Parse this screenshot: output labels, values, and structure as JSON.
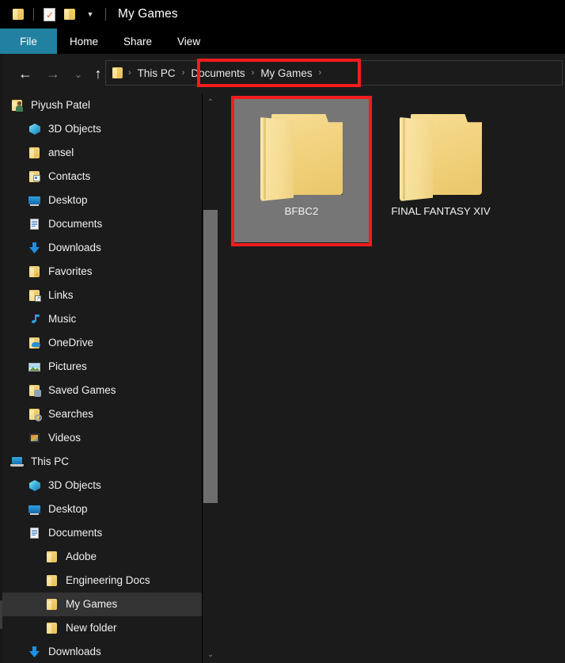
{
  "window": {
    "title": "My Games",
    "quick_access": [
      {
        "name": "folder-icon",
        "label": "Folder"
      },
      {
        "name": "properties-icon",
        "label": "Properties"
      },
      {
        "name": "new-folder-icon",
        "label": "New folder"
      },
      {
        "name": "customize-chevron-icon",
        "label": "Customize Quick Access Toolbar"
      }
    ]
  },
  "ribbon": {
    "tabs": [
      {
        "label": "File",
        "active": true
      },
      {
        "label": "Home",
        "active": false
      },
      {
        "label": "Share",
        "active": false
      },
      {
        "label": "View",
        "active": false
      }
    ],
    "accent_color": "#2280a0"
  },
  "nav": {
    "back": "←",
    "forward": "→",
    "recent": "⌄",
    "up": "↑",
    "breadcrumbs": [
      {
        "label": "This PC"
      },
      {
        "label": "Documents"
      },
      {
        "label": "My Games"
      }
    ],
    "separator": "›"
  },
  "annotations": {
    "color": "#f41c1c",
    "boxes": [
      {
        "name": "breadcrumb-highlight",
        "target": "Documents > My Games"
      },
      {
        "name": "selected-folder-highlight",
        "target": "BFBC2"
      }
    ]
  },
  "sidebar": {
    "scroll": {
      "up_arrow": "⌃",
      "down_arrow": "⌄"
    },
    "items": [
      {
        "label": "Piyush Patel",
        "icon": "user-icon",
        "indent": 0,
        "selected": false
      },
      {
        "label": "3D Objects",
        "icon": "3d-objects-icon",
        "indent": 1,
        "selected": false
      },
      {
        "label": "ansel",
        "icon": "folder-icon",
        "indent": 1,
        "selected": false
      },
      {
        "label": "Contacts",
        "icon": "contacts-folder-icon",
        "indent": 1,
        "selected": false
      },
      {
        "label": "Desktop",
        "icon": "desktop-icon",
        "indent": 1,
        "selected": false
      },
      {
        "label": "Documents",
        "icon": "documents-icon",
        "indent": 1,
        "selected": false
      },
      {
        "label": "Downloads",
        "icon": "downloads-icon",
        "indent": 1,
        "selected": false
      },
      {
        "label": "Favorites",
        "icon": "favorites-folder-icon",
        "indent": 1,
        "selected": false
      },
      {
        "label": "Links",
        "icon": "links-folder-icon",
        "indent": 1,
        "selected": false
      },
      {
        "label": "Music",
        "icon": "music-icon",
        "indent": 1,
        "selected": false
      },
      {
        "label": "OneDrive",
        "icon": "onedrive-folder-icon",
        "indent": 1,
        "selected": false
      },
      {
        "label": "Pictures",
        "icon": "pictures-icon",
        "indent": 1,
        "selected": false
      },
      {
        "label": "Saved Games",
        "icon": "saved-games-folder-icon",
        "indent": 1,
        "selected": false
      },
      {
        "label": "Searches",
        "icon": "searches-folder-icon",
        "indent": 1,
        "selected": false
      },
      {
        "label": "Videos",
        "icon": "videos-icon",
        "indent": 1,
        "selected": false
      },
      {
        "label": "This PC",
        "icon": "this-pc-icon",
        "indent": 0,
        "selected": false
      },
      {
        "label": "3D Objects",
        "icon": "3d-objects-icon",
        "indent": 1,
        "selected": false
      },
      {
        "label": "Desktop",
        "icon": "desktop-icon",
        "indent": 1,
        "selected": false
      },
      {
        "label": "Documents",
        "icon": "documents-icon",
        "indent": 1,
        "selected": false
      },
      {
        "label": "Adobe",
        "icon": "folder-icon",
        "indent": 2,
        "selected": false
      },
      {
        "label": "Engineering Docs",
        "icon": "folder-icon",
        "indent": 2,
        "selected": false
      },
      {
        "label": "My Games",
        "icon": "folder-icon",
        "indent": 2,
        "selected": true
      },
      {
        "label": "New folder",
        "icon": "folder-icon",
        "indent": 2,
        "selected": false
      },
      {
        "label": "Downloads",
        "icon": "downloads-icon",
        "indent": 1,
        "selected": false
      }
    ]
  },
  "content": {
    "items": [
      {
        "label": "BFBC2",
        "icon": "folder-icon",
        "selected": true
      },
      {
        "label": "FINAL FANTASY XIV",
        "icon": "folder-icon",
        "selected": false
      }
    ]
  }
}
